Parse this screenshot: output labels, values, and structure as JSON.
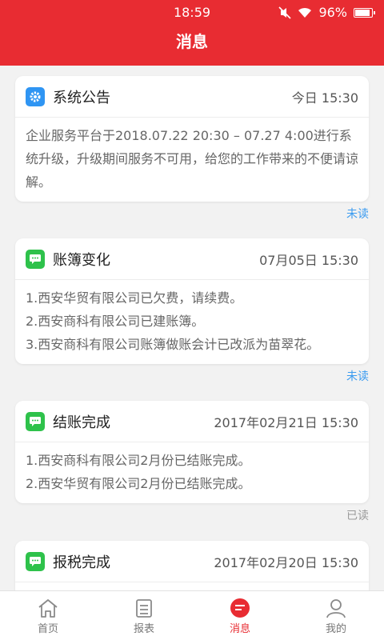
{
  "status_bar": {
    "time": "18:59",
    "battery": "96%",
    "battery_level": 0.96
  },
  "header": {
    "title": "消息"
  },
  "colors": {
    "accent": "#e82c32",
    "unread": "#3a9bf0",
    "read": "#999999",
    "notice_icon": "#2f95f3",
    "chat_icon": "#2ec24b"
  },
  "messages": [
    {
      "icon": "gear-icon",
      "title": "系统公告",
      "time": "今日 15:30",
      "lines": [
        "企业服务平台于2018.07.22 20:30 – 07.27 4:00进行系统升级，升级期间服务不可用，给您的工作带来的不便请谅解。"
      ],
      "status": "未读"
    },
    {
      "icon": "chat-icon",
      "title": "账簿变化",
      "time": "07月05日 15:30",
      "lines": [
        "1.西安华贸有限公司已欠费，请续费。",
        "2.西安商科有限公司已建账簿。",
        "3.西安商科有限公司账簿做账会计已改派为苗翠花。"
      ],
      "status": "未读"
    },
    {
      "icon": "chat-icon",
      "title": "结账完成",
      "time": "2017年02月21日 15:30",
      "lines": [
        "1.西安商科有限公司2月份已结账完成。",
        "2.西安华贸有限公司2月份已结账完成。"
      ],
      "status": "已读"
    },
    {
      "icon": "chat-icon",
      "title": "报税完成",
      "time": "2017年02月20日 15:30",
      "lines": [],
      "status": ""
    }
  ],
  "tabs": [
    {
      "label": "首页",
      "icon": "home-icon",
      "active": false
    },
    {
      "label": "报表",
      "icon": "report-icon",
      "active": false
    },
    {
      "label": "消息",
      "icon": "message-icon",
      "active": true
    },
    {
      "label": "我的",
      "icon": "profile-icon",
      "active": false
    }
  ]
}
